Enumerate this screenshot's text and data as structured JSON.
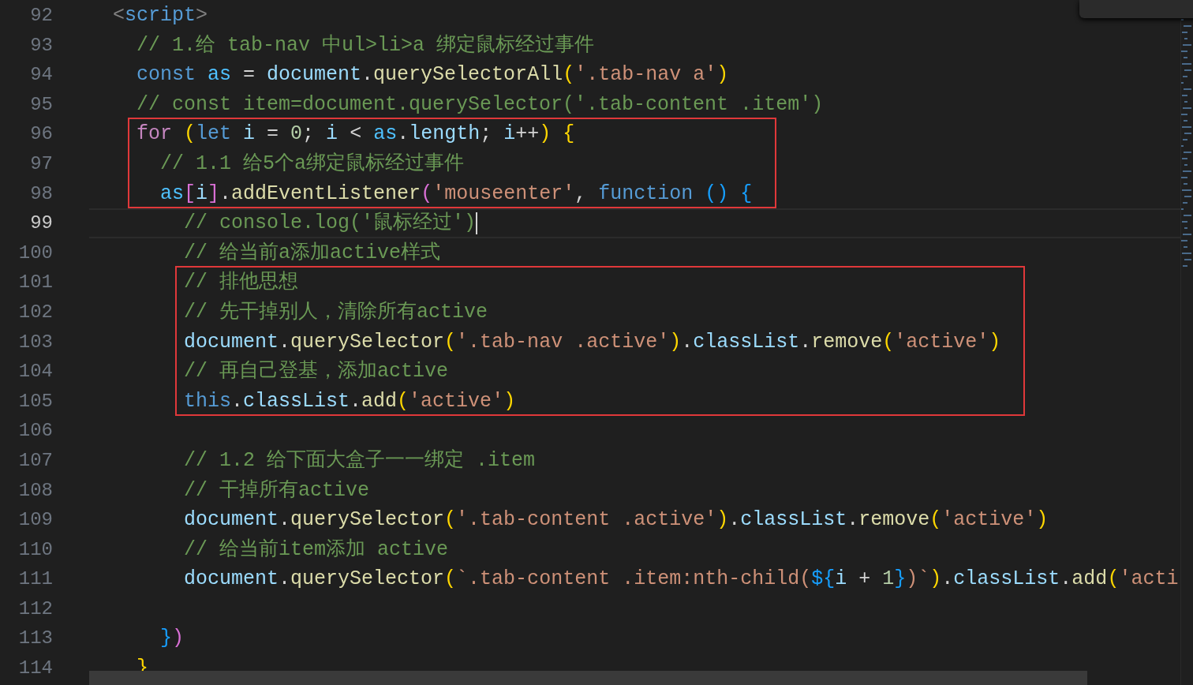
{
  "editor": {
    "lines": [
      {
        "number": "92",
        "current": false,
        "boxed": false,
        "tokens": [
          {
            "kind": "tg",
            "text": "<"
          },
          {
            "kind": "tn",
            "text": "script"
          },
          {
            "kind": "tg",
            "text": ">"
          }
        ],
        "children": [
          {
            "number": "93",
            "current": false,
            "boxed": false,
            "tokens": [
              {
                "kind": "cm",
                "text": "// 1.给 tab-nav 中ul>li>a 绑定鼠标经过事件"
              }
            ]
          },
          {
            "number": "94",
            "current": false,
            "boxed": false,
            "tokens": [
              {
                "kind": "st",
                "text": "const"
              },
              {
                "kind": "cn",
                "text": " as"
              },
              {
                "kind": "pl",
                "text": " = "
              },
              {
                "kind": "vr",
                "text": "document"
              },
              {
                "kind": "pl",
                "text": "."
              },
              {
                "kind": "fn",
                "text": "querySelectorAll"
              },
              {
                "kind": "b1",
                "text": "("
              },
              {
                "kind": "sg",
                "text": "'.tab-nav a'"
              },
              {
                "kind": "b1",
                "text": ")"
              }
            ]
          },
          {
            "number": "95",
            "current": false,
            "boxed": false,
            "tokens": [
              {
                "kind": "cm",
                "text": "// const item=document.querySelector('.tab-content .item')"
              }
            ]
          },
          {
            "number": "96",
            "current": false,
            "boxed": true,
            "tokens": [
              {
                "kind": "kw",
                "text": "for"
              },
              {
                "kind": "b1",
                "text": " ("
              },
              {
                "kind": "st",
                "text": "let"
              },
              {
                "kind": "vr",
                "text": " i"
              },
              {
                "kind": "pl",
                "text": " = "
              },
              {
                "kind": "nm",
                "text": "0"
              },
              {
                "kind": "pl",
                "text": "; "
              },
              {
                "kind": "vr",
                "text": "i"
              },
              {
                "kind": "pl",
                "text": " < "
              },
              {
                "kind": "cn",
                "text": "as"
              },
              {
                "kind": "pl",
                "text": "."
              },
              {
                "kind": "vr",
                "text": "length"
              },
              {
                "kind": "pl",
                "text": "; "
              },
              {
                "kind": "vr",
                "text": "i"
              },
              {
                "kind": "pl",
                "text": "++"
              },
              {
                "kind": "b1",
                "text": ")"
              },
              {
                "kind": "b1",
                "text": " {"
              }
            ],
            "children": [
              {
                "number": "97",
                "current": false,
                "boxed": true,
                "tokens": [
                  {
                    "kind": "cm",
                    "text": "// 1.1 给5个a绑定鼠标经过事件"
                  }
                ]
              },
              {
                "number": "98",
                "current": false,
                "boxed": true,
                "tokens": [
                  {
                    "kind": "cn",
                    "text": "as"
                  },
                  {
                    "kind": "b2",
                    "text": "["
                  },
                  {
                    "kind": "vr",
                    "text": "i"
                  },
                  {
                    "kind": "b2",
                    "text": "]"
                  },
                  {
                    "kind": "pl",
                    "text": "."
                  },
                  {
                    "kind": "fn",
                    "text": "addEventListener"
                  },
                  {
                    "kind": "b2",
                    "text": "("
                  },
                  {
                    "kind": "sg",
                    "text": "'mouseenter'"
                  },
                  {
                    "kind": "pl",
                    "text": ", "
                  },
                  {
                    "kind": "st",
                    "text": "function"
                  },
                  {
                    "kind": "b3",
                    "text": " ()"
                  },
                  {
                    "kind": "b3",
                    "text": " {"
                  }
                ],
                "children": [
                  {
                    "number": "99",
                    "current": true,
                    "boxed": false,
                    "tokens": [
                      {
                        "kind": "cm",
                        "text": "// console.log('鼠标经过')"
                      }
                    ]
                  },
                  {
                    "number": "100",
                    "current": false,
                    "boxed": false,
                    "tokens": [
                      {
                        "kind": "cm",
                        "text": "// 给当前a添加active样式"
                      }
                    ]
                  },
                  {
                    "number": "101",
                    "current": false,
                    "boxed": true,
                    "tokens": [
                      {
                        "kind": "cm",
                        "text": "// 排他思想"
                      }
                    ]
                  },
                  {
                    "number": "102",
                    "current": false,
                    "boxed": true,
                    "tokens": [
                      {
                        "kind": "cm",
                        "text": "// 先干掉别人，清除所有active"
                      }
                    ]
                  },
                  {
                    "number": "103",
                    "current": false,
                    "boxed": true,
                    "tokens": [
                      {
                        "kind": "vr",
                        "text": "document"
                      },
                      {
                        "kind": "pl",
                        "text": "."
                      },
                      {
                        "kind": "fn",
                        "text": "querySelector"
                      },
                      {
                        "kind": "b1",
                        "text": "("
                      },
                      {
                        "kind": "sg",
                        "text": "'.tab-nav .active'"
                      },
                      {
                        "kind": "b1",
                        "text": ")"
                      },
                      {
                        "kind": "pl",
                        "text": "."
                      },
                      {
                        "kind": "vr",
                        "text": "classList"
                      },
                      {
                        "kind": "pl",
                        "text": "."
                      },
                      {
                        "kind": "fn",
                        "text": "remove"
                      },
                      {
                        "kind": "b1",
                        "text": "("
                      },
                      {
                        "kind": "sg",
                        "text": "'active'"
                      },
                      {
                        "kind": "b1",
                        "text": ")"
                      }
                    ]
                  },
                  {
                    "number": "104",
                    "current": false,
                    "boxed": true,
                    "tokens": [
                      {
                        "kind": "cm",
                        "text": "// 再自己登基，添加active"
                      }
                    ]
                  },
                  {
                    "number": "105",
                    "current": false,
                    "boxed": true,
                    "tokens": [
                      {
                        "kind": "st",
                        "text": "this"
                      },
                      {
                        "kind": "pl",
                        "text": "."
                      },
                      {
                        "kind": "vr",
                        "text": "classList"
                      },
                      {
                        "kind": "pl",
                        "text": "."
                      },
                      {
                        "kind": "fn",
                        "text": "add"
                      },
                      {
                        "kind": "b1",
                        "text": "("
                      },
                      {
                        "kind": "sg",
                        "text": "'active'"
                      },
                      {
                        "kind": "b1",
                        "text": ")"
                      }
                    ]
                  },
                  {
                    "number": "106",
                    "current": false,
                    "boxed": false
                  },
                  {
                    "number": "107",
                    "current": false,
                    "boxed": false,
                    "tokens": [
                      {
                        "kind": "cm",
                        "text": "// 1.2 给下面大盒子一一绑定 .item"
                      }
                    ]
                  },
                  {
                    "number": "108",
                    "current": false,
                    "boxed": false,
                    "tokens": [
                      {
                        "kind": "cm",
                        "text": "// 干掉所有active"
                      }
                    ]
                  },
                  {
                    "number": "109",
                    "current": false,
                    "boxed": false,
                    "tokens": [
                      {
                        "kind": "vr",
                        "text": "document"
                      },
                      {
                        "kind": "pl",
                        "text": "."
                      },
                      {
                        "kind": "fn",
                        "text": "querySelector"
                      },
                      {
                        "kind": "b1",
                        "text": "("
                      },
                      {
                        "kind": "sg",
                        "text": "'.tab-content .active'"
                      },
                      {
                        "kind": "b1",
                        "text": ")"
                      },
                      {
                        "kind": "pl",
                        "text": "."
                      },
                      {
                        "kind": "vr",
                        "text": "classList"
                      },
                      {
                        "kind": "pl",
                        "text": "."
                      },
                      {
                        "kind": "fn",
                        "text": "remove"
                      },
                      {
                        "kind": "b1",
                        "text": "("
                      },
                      {
                        "kind": "sg",
                        "text": "'active'"
                      },
                      {
                        "kind": "b1",
                        "text": ")"
                      }
                    ]
                  },
                  {
                    "number": "110",
                    "current": false,
                    "boxed": false,
                    "tokens": [
                      {
                        "kind": "cm",
                        "text": "// 给当前item添加 active"
                      }
                    ]
                  },
                  {
                    "number": "111",
                    "current": false,
                    "boxed": false,
                    "tokens": [
                      {
                        "kind": "vr",
                        "text": "document"
                      },
                      {
                        "kind": "pl",
                        "text": "."
                      },
                      {
                        "kind": "fn",
                        "text": "querySelector"
                      },
                      {
                        "kind": "b1",
                        "text": "("
                      },
                      {
                        "kind": "sg",
                        "text": "`.tab-content .item:nth-child("
                      },
                      {
                        "kind": "b3",
                        "text": "${"
                      },
                      {
                        "kind": "vr",
                        "text": "i"
                      },
                      {
                        "kind": "pl",
                        "text": " + "
                      },
                      {
                        "kind": "nm",
                        "text": "1"
                      },
                      {
                        "kind": "b3",
                        "text": "}"
                      },
                      {
                        "kind": "sg",
                        "text": ")`"
                      },
                      {
                        "kind": "b1",
                        "text": ")"
                      },
                      {
                        "kind": "pl",
                        "text": "."
                      },
                      {
                        "kind": "vr",
                        "text": "classList"
                      },
                      {
                        "kind": "pl",
                        "text": "."
                      },
                      {
                        "kind": "fn",
                        "text": "add"
                      },
                      {
                        "kind": "b1",
                        "text": "("
                      },
                      {
                        "kind": "sg",
                        "text": "'acti"
                      }
                    ]
                  },
                  {
                    "number": "112",
                    "current": false,
                    "boxed": false
                  }
                ]
              },
              {
                "number": "113",
                "current": false,
                "boxed": false,
                "tokens": [
                  {
                    "kind": "b3",
                    "text": "}"
                  },
                  {
                    "kind": "b2",
                    "text": ")"
                  }
                ]
              }
            ]
          },
          {
            "number": "114",
            "current": false,
            "boxed": false,
            "tokens": [
              {
                "kind": "b1",
                "text": "}"
              }
            ]
          }
        ]
      }
    ]
  }
}
